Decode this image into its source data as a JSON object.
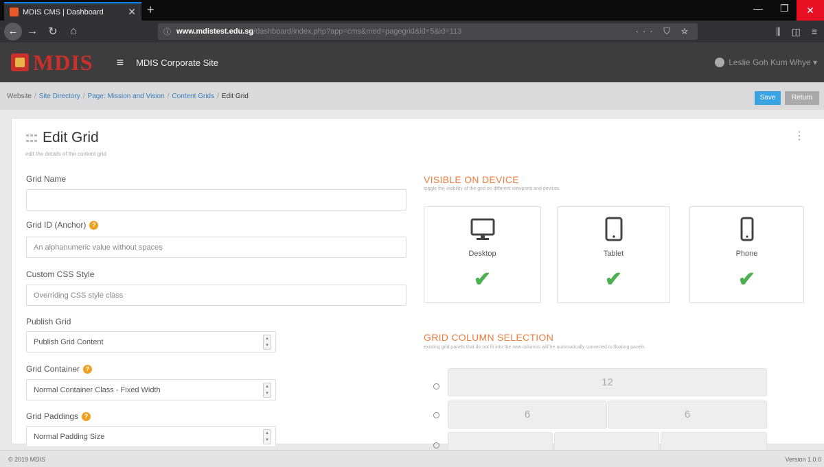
{
  "browser": {
    "tab_title": "MDIS CMS | Dashboard",
    "tab_close": "✕",
    "new_tab": "+",
    "url_domain": "www.mdistest.edu.sg",
    "url_prefix": "www.",
    "url_path": "/dashboard/index.php?app=cms&mod=pagegrid&id=5&id=113",
    "url_actions": "··· ⛉ ☆"
  },
  "header": {
    "logo_text": "MDIS",
    "site_name": "MDIS Corporate Site",
    "user_name": "Leslie Goh Kum Whye ▾"
  },
  "breadcrumb": {
    "items": [
      "Website",
      "Site Directory",
      "Page: Mission and Vision",
      "Content Grids",
      "Edit Grid"
    ],
    "separator": "/"
  },
  "toolbar": {
    "save_label": "Save",
    "return_label": "Return"
  },
  "page": {
    "title": "Edit Grid",
    "subtitle": "edit the details of the content grid"
  },
  "form": {
    "grid_name": {
      "label": "Grid Name",
      "value": "",
      "placeholder": ""
    },
    "grid_id": {
      "label": "Grid ID (Anchor)",
      "placeholder": "An alphanumeric value without spaces"
    },
    "custom_css": {
      "label": "Custom CSS Style",
      "placeholder": "Overriding CSS style class"
    },
    "publish": {
      "label": "Publish Grid",
      "selected": "Publish Grid Content"
    },
    "container": {
      "label": "Grid Container",
      "selected": "Normal Container Class - Fixed Width"
    },
    "paddings": {
      "label": "Grid Paddings",
      "selected": "Normal Padding Size"
    }
  },
  "visible_on_device": {
    "title": "VISIBLE ON DEVICE",
    "subtitle": "toggle the visibility of the grid on different viewports and devices",
    "devices": [
      {
        "name": "Desktop",
        "icon": "desktop-icon",
        "checked": true
      },
      {
        "name": "Tablet",
        "icon": "tablet-icon",
        "checked": true
      },
      {
        "name": "Phone",
        "icon": "phone-icon",
        "checked": true
      }
    ]
  },
  "column_selection": {
    "title": "GRID COLUMN SELECTION",
    "subtitle": "existing grid panels that do not fit into the new columns will be automatically converted to floating panels",
    "rows": [
      [
        "12"
      ],
      [
        "6",
        "6"
      ],
      [
        "",
        "",
        ""
      ]
    ]
  },
  "footer": {
    "copyright": "© 2019 MDIS",
    "version": "Version 1.0.0"
  },
  "colors": {
    "accent": "#f07c3c",
    "primary": "#3aa3e3",
    "brand": "#c9302c",
    "check": "#4caf50"
  }
}
